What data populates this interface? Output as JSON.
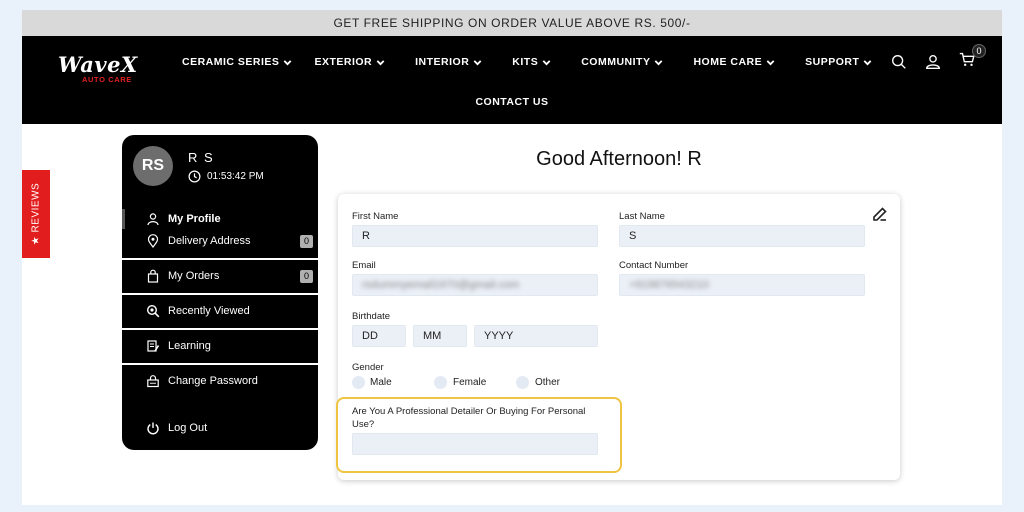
{
  "announcement": "GET FREE SHIPPING ON ORDER VALUE ABOVE RS. 500/-",
  "logo": {
    "name": "WaveX",
    "tagline": "AUTO CARE"
  },
  "nav": {
    "items": [
      "CERAMIC SERIES",
      "EXTERIOR",
      "INTERIOR",
      "KITS",
      "COMMUNITY",
      "HOME CARE",
      "SUPPORT"
    ],
    "contact": "CONTACT US"
  },
  "header_icons": {
    "search": "search-icon",
    "account": "user-icon",
    "cart": "cart-icon",
    "cart_count": "0"
  },
  "reviews_tab": "★ REVIEWS",
  "profile": {
    "initials": "RS",
    "name": "R S",
    "time": "01:53:42 PM"
  },
  "sidebar": {
    "my_profile": "My Profile",
    "delivery_address": "Delivery Address",
    "delivery_count": "0",
    "my_orders": "My Orders",
    "orders_count": "0",
    "recently_viewed": "Recently Viewed",
    "learning": "Learning",
    "change_password": "Change Password",
    "logout": "Log Out"
  },
  "greeting": "Good Afternoon! R",
  "form": {
    "first_name_label": "First Name",
    "first_name": "R",
    "last_name_label": "Last Name",
    "last_name": "S",
    "email_label": "Email",
    "email": "rsdummyemail1970@gmail.com",
    "contact_label": "Contact Number",
    "contact": "+919876543210",
    "birthdate_label": "Birthdate",
    "dd": "DD",
    "mm": "MM",
    "yyyy": "YYYY",
    "gender_label": "Gender",
    "gender_options": [
      "Male",
      "Female",
      "Other"
    ],
    "question_label": "Are You A Professional Detailer Or Buying For Personal Use?",
    "question_value": ""
  },
  "colors": {
    "accent_red": "#e21d1d",
    "highlight": "#f0c443",
    "header_bg": "#000000"
  }
}
